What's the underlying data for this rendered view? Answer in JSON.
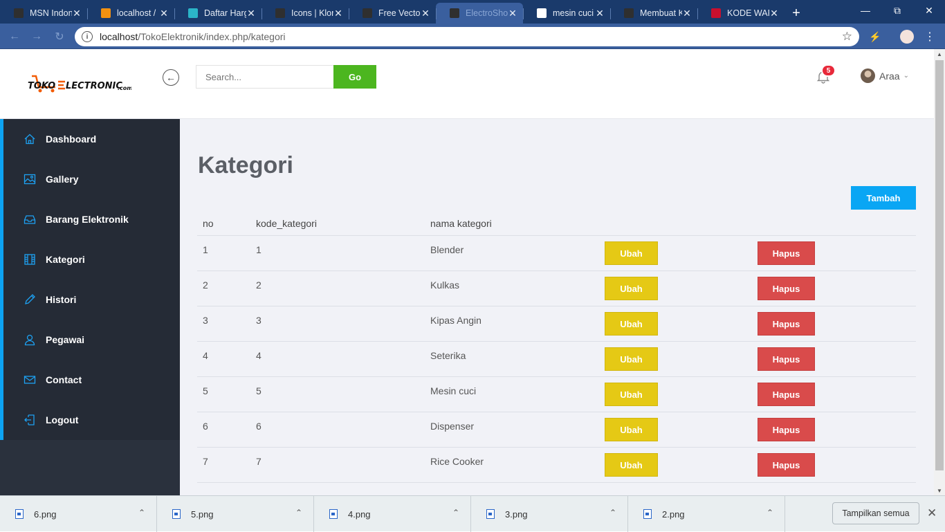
{
  "browser": {
    "tabs": [
      {
        "label": "MSN Indonesia",
        "icon": "msn-icon",
        "color": "#2f2f2f"
      },
      {
        "label": "localhost / ",
        "icon": "phpmyadmin-icon",
        "color": "#f29111"
      },
      {
        "label": "Daftar Harga",
        "icon": "diamond-icon",
        "color": "#2bb5c8"
      },
      {
        "label": "Icons | Klorofil",
        "icon": "leaf-icon",
        "color": "#2f2f2f"
      },
      {
        "label": "Free Vector",
        "icon": "gem-icon",
        "color": "#2f2f2f"
      },
      {
        "label": "ElectroShop",
        "icon": "leaf-icon",
        "color": "#2f2f2f"
      },
      {
        "label": "mesin cuci",
        "icon": "google-icon",
        "color": "#ffffff"
      },
      {
        "label": "Membuat K",
        "icon": "js-icon",
        "color": "#2f2f2f"
      },
      {
        "label": "KODE WARNA",
        "icon": "color-icon",
        "color": "#c8102e"
      }
    ],
    "url_host": "localhost",
    "url_path": "/TokoElektronik/index.php/kategori"
  },
  "header": {
    "logo_text": "TOKO ELECTRONIC.com",
    "search_placeholder": "Search...",
    "go_label": "Go",
    "notif_count": "5",
    "user_name": "Araa"
  },
  "sidebar": {
    "items": [
      {
        "label": "Dashboard",
        "icon": "home-icon"
      },
      {
        "label": "Gallery",
        "icon": "image-icon"
      },
      {
        "label": "Barang Elektronik",
        "icon": "inbox-icon"
      },
      {
        "label": "Kategori",
        "icon": "film-icon"
      },
      {
        "label": "Histori",
        "icon": "pencil-icon"
      },
      {
        "label": "Pegawai",
        "icon": "user-icon"
      },
      {
        "label": "Contact",
        "icon": "envelope-icon"
      },
      {
        "label": "Logout",
        "icon": "exit-icon"
      }
    ]
  },
  "main": {
    "title": "Kategori",
    "add_label": "Tambah",
    "columns": [
      "no",
      "kode_kategori",
      "nama kategori"
    ],
    "edit_label": "Ubah",
    "delete_label": "Hapus",
    "rows": [
      {
        "no": "1",
        "kode": "1",
        "nama": "Blender"
      },
      {
        "no": "2",
        "kode": "2",
        "nama": "Kulkas"
      },
      {
        "no": "3",
        "kode": "3",
        "nama": "Kipas Angin"
      },
      {
        "no": "4",
        "kode": "4",
        "nama": "Seterika"
      },
      {
        "no": "5",
        "kode": "5",
        "nama": "Mesin cuci"
      },
      {
        "no": "6",
        "kode": "6",
        "nama": "Dispenser"
      },
      {
        "no": "7",
        "kode": "7",
        "nama": "Rice Cooker"
      }
    ]
  },
  "downloads": {
    "files": [
      "6.png",
      "5.png",
      "4.png",
      "3.png",
      "2.png"
    ],
    "show_all_label": "Tampilkan semua"
  },
  "colors": {
    "accent": "#0da3f2",
    "go": "#4cb61f",
    "edit": "#e5c915",
    "delete": "#d94b4b",
    "sidebar": "#252b36"
  }
}
